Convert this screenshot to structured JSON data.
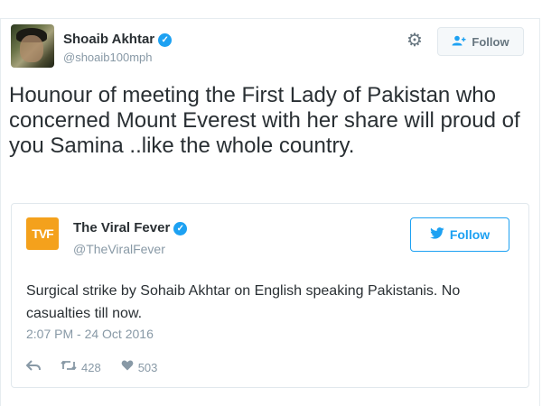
{
  "tweet": {
    "author_name": "Shoaib Akhtar",
    "author_handle": "@shoaib100mph",
    "follow_label": "Follow",
    "text": "Hounour of meeting the First Lady of Pakistan who concerned Mount Everest with her share will proud  of you Samina ..like the whole country."
  },
  "quoted": {
    "logo_text": "TVF",
    "author_name": "The Viral Fever",
    "author_handle": "@TheViralFever",
    "follow_label": "Follow",
    "text": "Surgical strike by Sohaib Akhtar on English speaking Pakistanis. No casualties till now.",
    "timestamp": "2:07 PM - 24 Oct 2016",
    "retweets": "428",
    "likes": "503"
  },
  "icons": {
    "verified": "verified-badge-icon",
    "settings": "gear-icon",
    "follow_user": "person-add-icon",
    "twitter_bird": "twitter-bird-icon",
    "reply": "reply-icon",
    "retweet": "retweet-icon",
    "like": "heart-icon"
  },
  "colors": {
    "accent": "#1da1f2",
    "text": "#292f33",
    "muted": "#8899a6",
    "tvf_logo": "#f4a11c"
  }
}
